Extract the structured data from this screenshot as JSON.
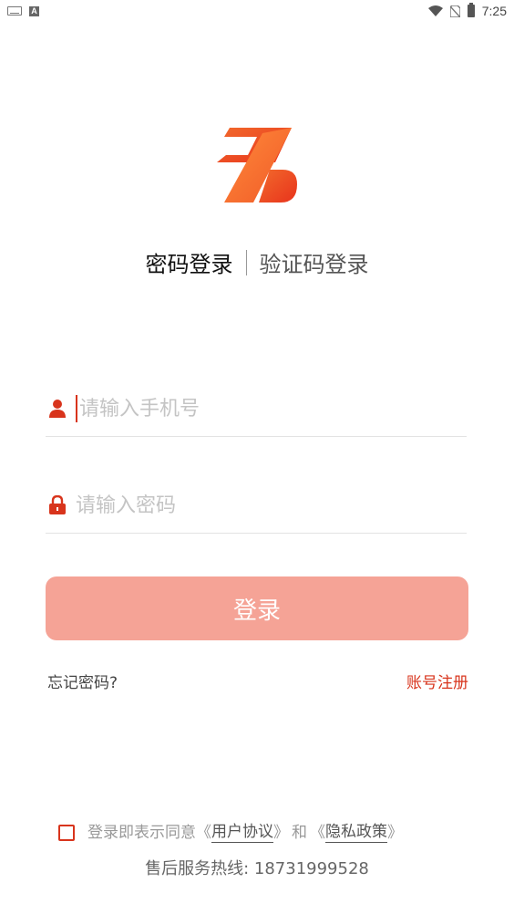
{
  "status_bar": {
    "time": "7:25",
    "icons": [
      "keyboard-icon",
      "a-notification-icon",
      "wifi-icon",
      "no-sim-icon",
      "battery-icon"
    ]
  },
  "logo": {
    "name": "z-logo",
    "colors": [
      "#f05a28",
      "#e8331c"
    ]
  },
  "tabs": {
    "active": "密码登录",
    "inactive": "验证码登录"
  },
  "form": {
    "phone_placeholder": "请输入手机号",
    "password_placeholder": "请输入密码",
    "phone_icon": "user-icon",
    "password_icon": "lock-icon"
  },
  "actions": {
    "login_label": "登录",
    "forgot_label": "忘记密码?",
    "register_label": "账号注册"
  },
  "agreement": {
    "prefix": "登录即表示同意",
    "open_1": "《",
    "user_agreement": "用户协议",
    "close_1": "》",
    "and": "和",
    "open_2": "《",
    "privacy_policy": "隐私政策",
    "close_2": "》",
    "checked": false
  },
  "hotline": "售后服务热线: 18731999528",
  "colors": {
    "accent": "#d8341c",
    "button_disabled": "#f5a396"
  }
}
